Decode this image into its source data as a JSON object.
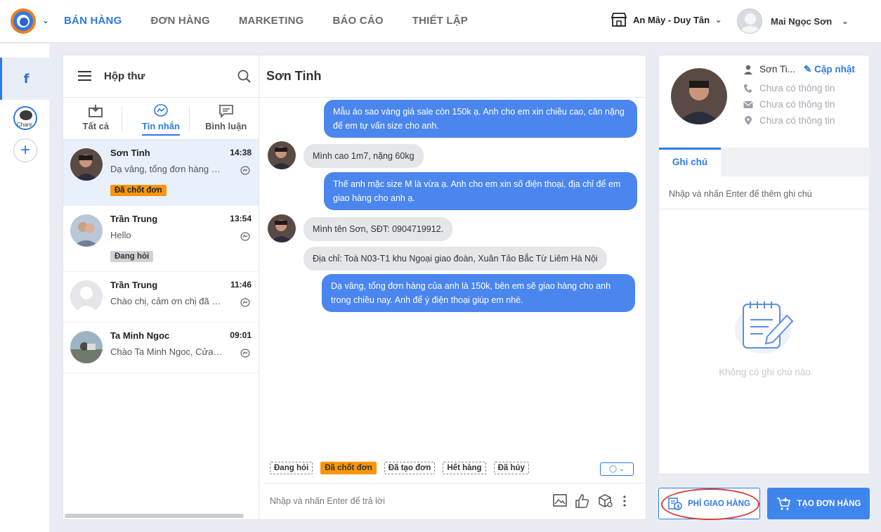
{
  "nav": {
    "items": [
      "BÁN HÀNG",
      "ĐƠN HÀNG",
      "MARKETING",
      "BÁO CÁO",
      "THIẾT LẬP"
    ],
    "active": "BÁN HÀNG"
  },
  "store": "An Mây - Duy Tân",
  "user": "Mai Ngọc Sơn",
  "leftrail": {
    "facebook": "f",
    "channel_label": "Chanr"
  },
  "inbox": {
    "title": "Hộp thư",
    "filters": [
      "Tất cả",
      "Tin nhắn",
      "Bình luận"
    ],
    "conversations": [
      {
        "name": "Sơn Tinh",
        "time": "14:38",
        "preview": "Dạ vâng, tổng đơn hàng của",
        "tag": "Đã chốt đơn"
      },
      {
        "name": "Trần Trung",
        "time": "13:54",
        "preview": "Hello",
        "tag": "Đang hỏi"
      },
      {
        "name": "Trần Trung",
        "time": "11:46",
        "preview": "Chào chị, cảm ơn chị đã q ...",
        "tag": ""
      },
      {
        "name": "Ta Minh Ngoc",
        "time": "09:01",
        "preview": "Chào Ta Minh Ngoc, Cửa ...",
        "tag": ""
      }
    ]
  },
  "chat": {
    "title": "Sơn Tinh",
    "messages": [
      {
        "dir": "out",
        "text": "Mẫu áo sao vàng giá sale còn 150k ạ. Anh cho em xin chiều cao, cân nặng để em tự vấn size cho anh."
      },
      {
        "dir": "in",
        "text": "Mình cao 1m7, nặng 60kg"
      },
      {
        "dir": "out",
        "text": "Thế anh mặc size M là vừa ạ. Anh cho em xin số điện thoại, địa chỉ để em giao hàng cho anh ạ."
      },
      {
        "dir": "in",
        "text": "Mình tên Sơn, SĐT: 0904719912."
      },
      {
        "dir": "in",
        "text": "Địa chỉ: Toà N03-T1 khu Ngoại giao đoàn, Xuân Tảo Bắc Từ Liêm Hà Nội"
      },
      {
        "dir": "out",
        "text": "Dạ vâng, tổng đơn hàng của anh là 150k, bên em sẽ giao hàng cho anh trong chiều nay. Anh để ý điện thoại giúp em nhé."
      }
    ],
    "tags": [
      "Đang hỏi",
      "Đã chốt đơn",
      "Đã tạo đơn",
      "Hết hàng",
      "Đã hủy"
    ],
    "input_placeholder": "Nhập và nhấn Enter để trả lời"
  },
  "profile": {
    "name": "Sơn Ti...",
    "update": "Cập nhật",
    "phone": "Chưa có thông tin",
    "email": "Chưa có thông tin",
    "address": "Chưa có thông tin"
  },
  "notes": {
    "tab": "Ghi chú",
    "placeholder": "Nhập và nhấn Enter để thêm ghi chú",
    "empty": "Không có ghi chú nào"
  },
  "actions": {
    "fee": "PHÍ GIAO HÀNG",
    "create": "TẠO ĐƠN HÀNG"
  },
  "colors": {
    "accent": "#2f7ae5",
    "bubble_out": "#4a86ee",
    "tag_orange": "#f7960b",
    "highlight_ring": "#d4403a"
  }
}
